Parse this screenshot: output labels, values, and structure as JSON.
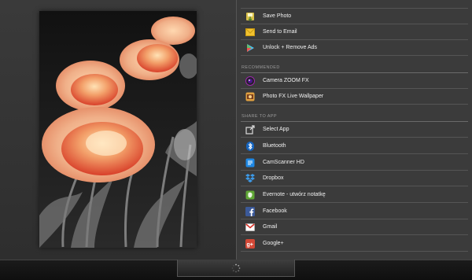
{
  "top_items": [
    {
      "label": "Save Photo",
      "icon": "save-photo-icon"
    },
    {
      "label": "Send to Email",
      "icon": "email-icon"
    },
    {
      "label": "Unlock + Remove Ads",
      "icon": "play-store-icon"
    }
  ],
  "recommended": {
    "header": "RECOMMENDED",
    "items": [
      {
        "label": "Camera ZOOM FX",
        "icon": "camera-zoom-fx-icon"
      },
      {
        "label": "Photo FX Live Wallpaper",
        "icon": "photo-fx-icon"
      }
    ]
  },
  "share": {
    "header": "SHARE TO APP",
    "items": [
      {
        "label": "Select App",
        "icon": "select-app-icon"
      },
      {
        "label": "Bluetooth",
        "icon": "bluetooth-icon"
      },
      {
        "label": "CamScanner HD",
        "icon": "camscanner-icon"
      },
      {
        "label": "Dropbox",
        "icon": "dropbox-icon"
      },
      {
        "label": "Evernote - utwórz notatkę",
        "icon": "evernote-icon"
      },
      {
        "label": "Facebook",
        "icon": "facebook-icon"
      },
      {
        "label": "Gmail",
        "icon": "gmail-icon"
      },
      {
        "label": "Google+",
        "icon": "google-plus-icon"
      }
    ]
  },
  "colors": {
    "panel_bg": "#3b3b3b",
    "divider": "#555555",
    "text": "#f0f0f0",
    "header_text": "#9a9a9a"
  }
}
